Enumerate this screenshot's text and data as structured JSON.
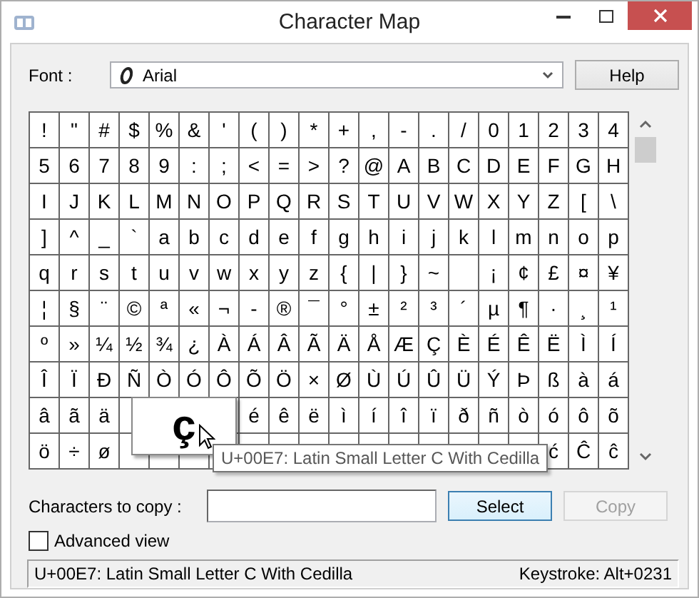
{
  "window": {
    "title": "Character Map"
  },
  "font": {
    "label": "Font :",
    "value": "Arial"
  },
  "help_button": "Help",
  "grid": {
    "rows": [
      [
        "!",
        "\"",
        "#",
        "$",
        "%",
        "&",
        "'",
        "(",
        ")",
        "*",
        "+",
        ",",
        "-",
        ".",
        "/",
        "0",
        "1",
        "2",
        "3",
        "4"
      ],
      [
        "5",
        "6",
        "7",
        "8",
        "9",
        ":",
        ";",
        "<",
        "=",
        ">",
        "?",
        "@",
        "A",
        "B",
        "C",
        "D",
        "E",
        "F",
        "G",
        "H"
      ],
      [
        "I",
        "J",
        "K",
        "L",
        "M",
        "N",
        "O",
        "P",
        "Q",
        "R",
        "S",
        "T",
        "U",
        "V",
        "W",
        "X",
        "Y",
        "Z",
        "[",
        "\\"
      ],
      [
        "]",
        "^",
        "_",
        "`",
        "a",
        "b",
        "c",
        "d",
        "e",
        "f",
        "g",
        "h",
        "i",
        "j",
        "k",
        "l",
        "m",
        "n",
        "o",
        "p"
      ],
      [
        "q",
        "r",
        "s",
        "t",
        "u",
        "v",
        "w",
        "x",
        "y",
        "z",
        "{",
        "|",
        "}",
        "~",
        null,
        "¡",
        "¢",
        "£",
        "¤",
        "¥"
      ],
      [
        "¦",
        "§",
        "¨",
        "©",
        "ª",
        "«",
        "¬",
        "-",
        "®",
        "¯",
        "°",
        "±",
        "²",
        "³",
        "´",
        "µ",
        "¶",
        "·",
        "¸",
        "¹"
      ],
      [
        "º",
        "»",
        "¼",
        "½",
        "¾",
        "¿",
        "À",
        "Á",
        "Â",
        "Ã",
        "Ä",
        "Å",
        "Æ",
        "Ç",
        "È",
        "É",
        "Ê",
        "Ë",
        "Ì",
        "Í"
      ],
      [
        "Î",
        "Ï",
        "Ð",
        "Ñ",
        "Ò",
        "Ó",
        "Ô",
        "Õ",
        "Ö",
        "×",
        "Ø",
        "Ù",
        "Ú",
        "Û",
        "Ü",
        "Ý",
        "Þ",
        "ß",
        "à",
        "á"
      ],
      [
        "â",
        "ã",
        "ä",
        null,
        null,
        null,
        null,
        "é",
        "ê",
        "ë",
        "ì",
        "í",
        "î",
        "ï",
        "ð",
        "ñ",
        "ò",
        "ó",
        "ô",
        "õ"
      ],
      [
        "ö",
        "÷",
        "ø",
        null,
        null,
        null,
        null,
        null,
        null,
        null,
        null,
        null,
        null,
        null,
        null,
        null,
        null,
        "ć",
        "Ĉ",
        "ĉ"
      ]
    ]
  },
  "magnified": "ç",
  "tooltip": "U+00E7: Latin Small Letter C With Cedilla",
  "copy": {
    "label": "Characters to copy :"
  },
  "select_button": "Select",
  "copy_button": {
    "label": "Copy",
    "disabled": true
  },
  "advanced_view": {
    "label": "Advanced view",
    "checked": false
  },
  "status_bar": {
    "description": "U+00E7: Latin Small Letter C With Cedilla",
    "keystroke": "Keystroke: Alt+0231"
  }
}
